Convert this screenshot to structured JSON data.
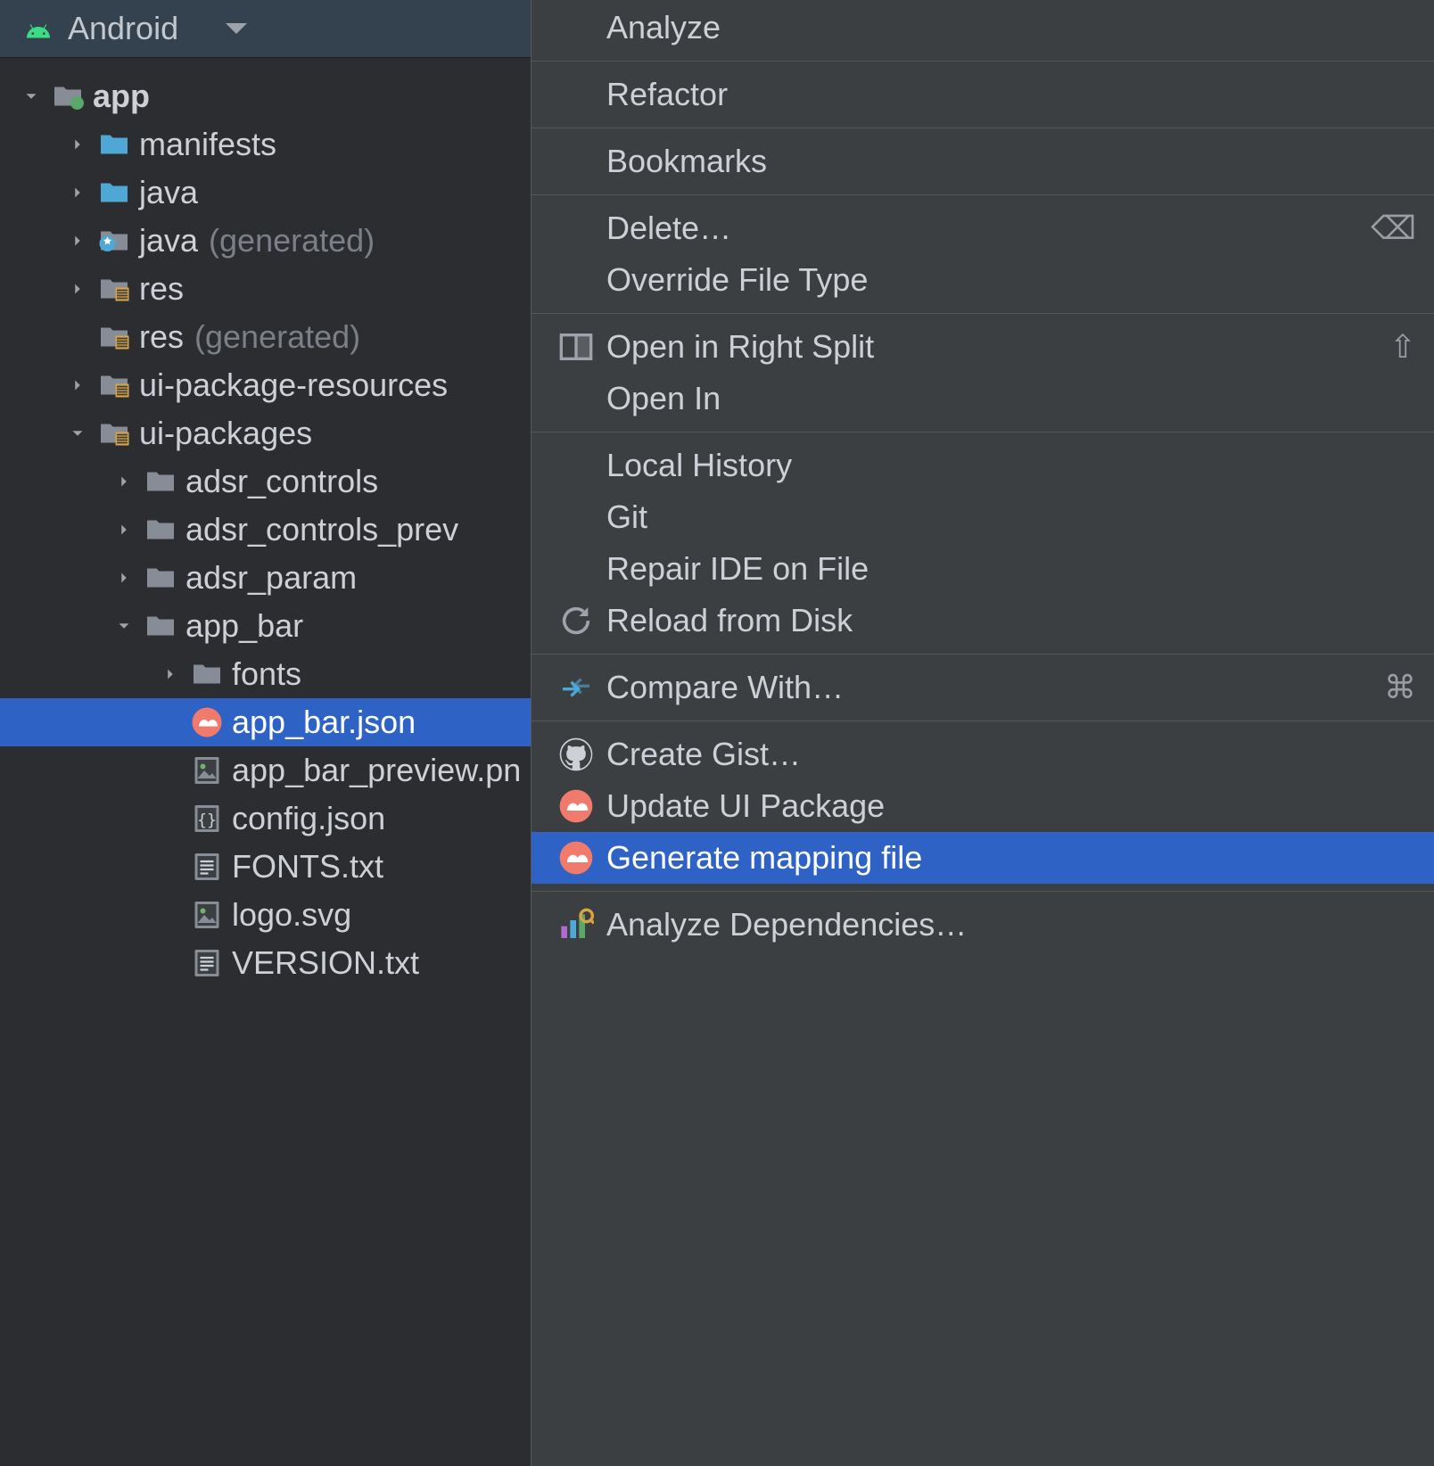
{
  "panel": {
    "title": "Android"
  },
  "tree": [
    {
      "indent": 0,
      "arrow": "down",
      "icon": "module-folder",
      "label": "app",
      "bold": true
    },
    {
      "indent": 1,
      "arrow": "right",
      "icon": "folder-blue",
      "label": "manifests"
    },
    {
      "indent": 1,
      "arrow": "right",
      "icon": "folder-blue",
      "label": "java"
    },
    {
      "indent": 1,
      "arrow": "right",
      "icon": "folder-gen",
      "label": "java",
      "suffix": "(generated)"
    },
    {
      "indent": 1,
      "arrow": "right",
      "icon": "folder-res",
      "label": "res"
    },
    {
      "indent": 1,
      "arrow": "none",
      "icon": "folder-res",
      "label": "res",
      "suffix": "(generated)"
    },
    {
      "indent": 1,
      "arrow": "right",
      "icon": "folder-res",
      "label": "ui-package-resources"
    },
    {
      "indent": 1,
      "arrow": "down",
      "icon": "folder-res",
      "label": "ui-packages"
    },
    {
      "indent": 2,
      "arrow": "right",
      "icon": "folder-grey",
      "label": "adsr_controls"
    },
    {
      "indent": 2,
      "arrow": "right",
      "icon": "folder-grey",
      "label": "adsr_controls_prev"
    },
    {
      "indent": 2,
      "arrow": "right",
      "icon": "folder-grey",
      "label": "adsr_param"
    },
    {
      "indent": 2,
      "arrow": "down",
      "icon": "folder-grey",
      "label": "app_bar"
    },
    {
      "indent": 3,
      "arrow": "right",
      "icon": "folder-grey",
      "label": "fonts"
    },
    {
      "indent": 3,
      "arrow": "none",
      "icon": "relay-pink",
      "label": "app_bar.json",
      "selected": true
    },
    {
      "indent": 3,
      "arrow": "none",
      "icon": "image-file",
      "label": "app_bar_preview.pn"
    },
    {
      "indent": 3,
      "arrow": "none",
      "icon": "json-file",
      "label": "config.json"
    },
    {
      "indent": 3,
      "arrow": "none",
      "icon": "text-file",
      "label": "FONTS.txt"
    },
    {
      "indent": 3,
      "arrow": "none",
      "icon": "image-file",
      "label": "logo.svg"
    },
    {
      "indent": 3,
      "arrow": "none",
      "icon": "text-file",
      "label": "VERSION.txt"
    }
  ],
  "menu": [
    {
      "type": "item",
      "label": "Analyze"
    },
    {
      "type": "sep"
    },
    {
      "type": "item",
      "label": "Refactor"
    },
    {
      "type": "sep"
    },
    {
      "type": "item",
      "label": "Bookmarks"
    },
    {
      "type": "sep"
    },
    {
      "type": "item",
      "label": "Delete…",
      "shortcut": "⌫"
    },
    {
      "type": "item",
      "label": "Override File Type"
    },
    {
      "type": "sep"
    },
    {
      "type": "item",
      "icon": "split-right",
      "label": "Open in Right Split",
      "shortcut": "⇧"
    },
    {
      "type": "item",
      "label": "Open In"
    },
    {
      "type": "sep"
    },
    {
      "type": "item",
      "label": "Local History"
    },
    {
      "type": "item",
      "label": "Git"
    },
    {
      "type": "item",
      "label": "Repair IDE on File"
    },
    {
      "type": "item",
      "icon": "reload",
      "label": "Reload from Disk"
    },
    {
      "type": "sep"
    },
    {
      "type": "item",
      "icon": "compare",
      "label": "Compare With…",
      "shortcut": "⌘"
    },
    {
      "type": "sep"
    },
    {
      "type": "item",
      "icon": "github",
      "label": "Create Gist…"
    },
    {
      "type": "item",
      "icon": "relay-pink",
      "label": "Update UI Package"
    },
    {
      "type": "item",
      "icon": "relay-pink",
      "label": "Generate mapping file",
      "highlighted": true
    },
    {
      "type": "sep"
    },
    {
      "type": "item",
      "icon": "analyze-deps",
      "label": "Analyze Dependencies…"
    }
  ]
}
